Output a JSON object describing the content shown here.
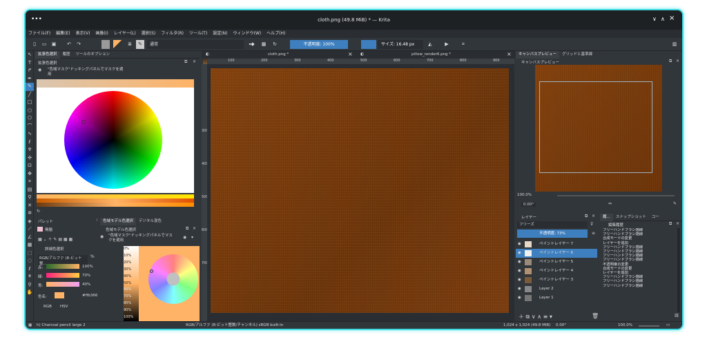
{
  "window": {
    "title": "cloth.png (49.8 MiB) * — Krita"
  },
  "menu": [
    "ファイル(F)",
    "編集(E)",
    "表示(V)",
    "画像(I)",
    "レイヤー(L)",
    "選択(S)",
    "フィルタ(R)",
    "ツール(T)",
    "設定(N)",
    "ウィンドウ(W)",
    "ヘルプ(H)"
  ],
  "toolbar": {
    "blend_mode": "通常",
    "opacity": "不透明度: 100%",
    "size": "サイズ: 16.48 px"
  },
  "left_tabs": [
    "拡張色選択",
    "履歴",
    "ツールのオプション"
  ],
  "color_selector": {
    "title": "拡張色選択",
    "info": "\"色域マスク\"ドッキングパネルでマスクを適用"
  },
  "palette": {
    "title": "パレット",
    "name": "無題"
  },
  "specific_color": {
    "title": "詳細色選択",
    "model": "RGB/アルファ (8-ビット整...",
    "rows": [
      {
        "label": "赤:",
        "value": "100%"
      },
      {
        "label": "緑:",
        "value": "70%"
      },
      {
        "label": "青:",
        "value": "40%"
      }
    ],
    "color_label": "色名:",
    "hex": "#ffb366",
    "modes": [
      "RGB",
      "HSV"
    ]
  },
  "mid_tabs": [
    "色域モデル色選択",
    "デジタル混色"
  ],
  "gamut": {
    "title": "色域モデル色選択",
    "info": "\"色域マスク\"ドッキングパネルでマスクを適用",
    "steps": [
      "0%",
      "10%",
      "20%",
      "30%",
      "40%",
      "50%",
      "60%",
      "70%",
      "80%",
      "90%",
      "100%"
    ]
  },
  "doc_tabs": [
    "cloth.png *",
    "pillow_render6.png *"
  ],
  "ruler_h": [
    "100",
    "200",
    "300",
    "400",
    "500",
    "600",
    "700",
    "800",
    "900"
  ],
  "ruler_v": [
    "300",
    "400",
    "500",
    "600",
    "700"
  ],
  "right_tabs": [
    "キャンバスプレビュー",
    "グリッドと基準線"
  ],
  "preview": {
    "title": "キャンバスプレビュー",
    "zoom": "100.0%",
    "rotation": "0.00°"
  },
  "layers": {
    "title": "レイヤー",
    "mode": "フリーズ",
    "opacity": "不透明度: 73%",
    "items": [
      "ペイントレイヤー 7",
      "ペイントレイヤー 6",
      "ペイントレイヤー 5",
      "ペイントレイヤー 4",
      "ペイントレイヤー 3",
      "Layer 2",
      "Layer 1"
    ]
  },
  "history_tabs": [
    "履...",
    "スナップショット",
    "コー"
  ],
  "history": {
    "title": "編集履歴",
    "items": [
      "フリーハンドブラシ描線",
      "フリーハンドブラシ描線",
      "合成モードの変更",
      "レイヤーを追加",
      "フリーハンドブラシ描線",
      "フリーハンドブラシ描線",
      "フリーハンドブラシ描線",
      "フリーハンドブラシ描線",
      "不透明度の変更",
      "合成モードの変更",
      "レイヤーを追加",
      "フリーハンドブラシ描線",
      "フリーハンドブラシ描線",
      "フリーハンドブラシ描線"
    ]
  },
  "status": {
    "brush": "h) Charcoal pencil large 2",
    "colorspace": "RGB/アルファ (8-ビット整数/チャンネル) sRGB built-in",
    "dimensions": "1,024 x 1,024 (49.8 MiB)",
    "rotation": "0.00°",
    "zoom": "100.0%"
  },
  "colors": {
    "accent": "#3e7fbf",
    "fg_color": "#ffb366"
  }
}
